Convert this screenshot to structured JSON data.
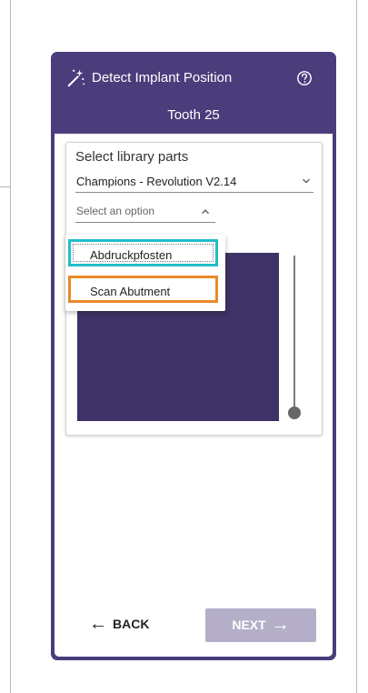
{
  "header": {
    "title": "Detect Implant Position",
    "subtitle": "Tooth 25",
    "wand_icon": "magic-wand-icon",
    "help_icon": "help-icon"
  },
  "library": {
    "label": "Select library parts",
    "library_select_value": "Champions - Revolution V2.14",
    "part_select_value": "Select an option"
  },
  "dropdown": {
    "options": [
      {
        "label": "Abdruckpfosten",
        "highlight": "#21bdc8"
      },
      {
        "label": "Scan Abutment",
        "highlight": "#e98a2b"
      }
    ]
  },
  "footer": {
    "back_label": "BACK",
    "back_arrow": "←",
    "next_label": "NEXT",
    "next_arrow": "→"
  },
  "colors": {
    "panel_header": "#4b3d7c",
    "preview": "#3e3266",
    "next_button_disabled": "#b4aec8",
    "option_one_highlight": "#21bdc8",
    "option_two_highlight": "#e98a2b"
  }
}
